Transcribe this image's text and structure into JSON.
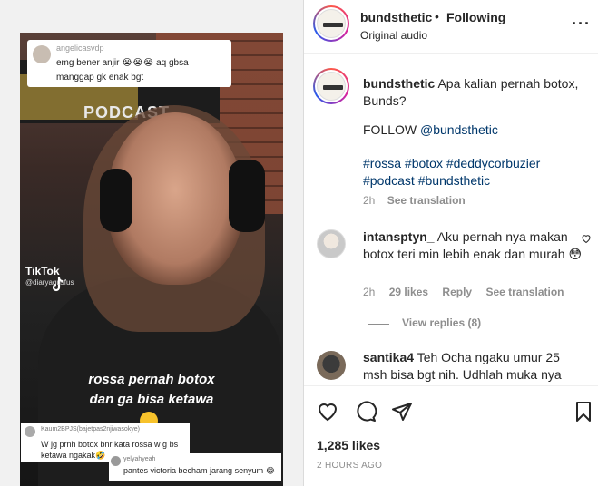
{
  "video": {
    "top_comment": {
      "user": "angelicasvdp",
      "text": "emg bener anjir 😭😭😭 aq gbsa manggap gk enak bgt"
    },
    "banner": "PODCAST",
    "tiktok_label": "TikTok",
    "tiktok_user": "@diaryagusfus",
    "caption": "rossa pernah botox dan ga bisa ketawa",
    "bottom_comment_1": {
      "user": "Kaum2BPJS(bajetpas2njiwasokye)",
      "text": "W jg prnh botox bnr kata rossa w g bs ketawa ngakak🤣"
    },
    "bottom_comment_2": {
      "user": "yelyahyeah",
      "text": "pantes victoria becham jarang senyum 😂"
    }
  },
  "header": {
    "username": "bundsthetic",
    "separator": "•",
    "follow_status": "Following",
    "audio": "Original audio",
    "more_icon": "more-horizontal-icon"
  },
  "post": {
    "username": "bundsthetic",
    "caption": "Apa kalian pernah botox, Bunds?",
    "follow_prefix": "FOLLOW ",
    "follow_handle": "@bundsthetic",
    "hashtags": "#rossa #botox #deddycorbuzier #podcast #bundsthetic",
    "time": "2h",
    "see_translation": "See translation"
  },
  "comments": [
    {
      "username": "intansptyn_",
      "text": "Aku pernah nya makan botox teri min lebih enak dan murah 😳",
      "time": "2h",
      "likes": "29 likes",
      "reply": "Reply",
      "see_translation": "See translation",
      "view_replies": "View replies (8)"
    },
    {
      "username": "santika4",
      "text": "Teh Ocha ngaku umur 25 msh bisa bgt nih. Udhlah muka nya"
    }
  ],
  "actions": {
    "likes": "1,285 likes",
    "time": "2 HOURS AGO"
  }
}
